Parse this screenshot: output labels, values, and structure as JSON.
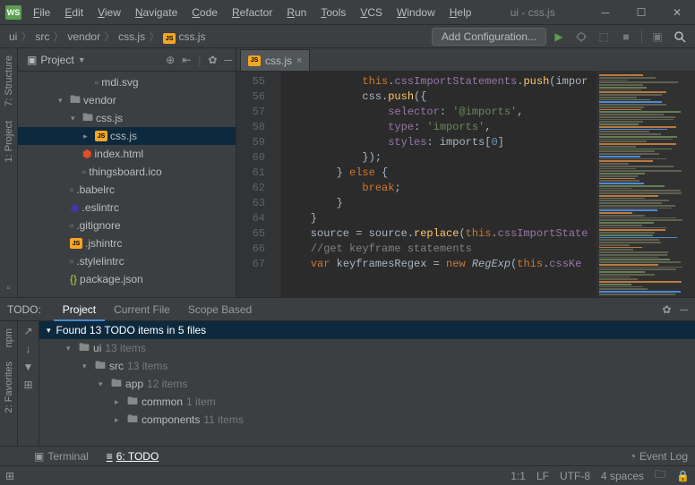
{
  "window": {
    "title": "ui - css.js"
  },
  "menu": [
    "File",
    "Edit",
    "View",
    "Navigate",
    "Code",
    "Refactor",
    "Run",
    "Tools",
    "VCS",
    "Window",
    "Help"
  ],
  "breadcrumbs": [
    "ui",
    "src",
    "vendor",
    "css.js",
    "css.js"
  ],
  "nav": {
    "add_config": "Add Configuration..."
  },
  "project_pane": {
    "title": "Project"
  },
  "tree": [
    {
      "indent": 66,
      "icon": "file",
      "label": "mdi.svg",
      "caret": ""
    },
    {
      "indent": 38,
      "icon": "folder",
      "label": "vendor",
      "caret": "▾"
    },
    {
      "indent": 52,
      "icon": "folder",
      "label": "css.js",
      "caret": "▾"
    },
    {
      "indent": 66,
      "icon": "js",
      "label": "css.js",
      "caret": "▸",
      "sel": true
    },
    {
      "indent": 52,
      "icon": "html",
      "label": "index.html",
      "caret": ""
    },
    {
      "indent": 52,
      "icon": "img",
      "label": "thingsboard.ico",
      "caret": ""
    },
    {
      "indent": 38,
      "icon": "file",
      "label": ".babelrc",
      "caret": ""
    },
    {
      "indent": 38,
      "icon": "eslint",
      "label": ".eslintrc",
      "caret": ""
    },
    {
      "indent": 38,
      "icon": "file",
      "label": ".gitignore",
      "caret": ""
    },
    {
      "indent": 38,
      "icon": "js",
      "label": ".jshintrc",
      "caret": ""
    },
    {
      "indent": 38,
      "icon": "file",
      "label": ".stylelintrc",
      "caret": ""
    },
    {
      "indent": 38,
      "icon": "json",
      "label": "package.json",
      "caret": ""
    }
  ],
  "editor": {
    "tab": "css.js",
    "first_line": 55,
    "lines": [
      {
        "n": 55,
        "html": "            <span class='this'>this</span>.<span class='prop'>cssImportStatements</span>.<span class='fn'>push</span>(impor"
      },
      {
        "n": 56,
        "html": "            css.<span class='fn'>push</span>({"
      },
      {
        "n": 57,
        "html": "                <span class='prop'>selector</span>: <span class='str'>'@imports'</span>,"
      },
      {
        "n": 58,
        "html": "                <span class='prop'>type</span>: <span class='str'>'imports'</span>,"
      },
      {
        "n": 59,
        "html": "                <span class='prop'>styles</span>: imports[<span class='num'>0</span>]"
      },
      {
        "n": 60,
        "html": "            });"
      },
      {
        "n": 61,
        "html": "        } <span class='kw'>else</span> {"
      },
      {
        "n": 62,
        "html": "            <span class='kw'>break</span>;"
      },
      {
        "n": 63,
        "html": "        }"
      },
      {
        "n": 64,
        "html": "    }"
      },
      {
        "n": 65,
        "html": "    source = source.<span class='fn'>replace</span>(<span class='this'>this</span>.<span class='prop'>cssImportState</span>"
      },
      {
        "n": 66,
        "html": "    <span class='cm'>//get keyframe statements</span>"
      },
      {
        "n": 67,
        "html": "    <span class='kw'>var</span> keyframesRegex = <span class='new'>new</span> <span class='type'>RegExp</span>(<span class='this'>this</span>.<span class='prop'>cssKe</span>"
      }
    ]
  },
  "todo": {
    "title": "TODO:",
    "tabs": [
      "Project",
      "Current File",
      "Scope Based"
    ],
    "header": "Found 13 TODO items in 5 files",
    "rows": [
      {
        "indent": 26,
        "caret": "▾",
        "icon": "folder",
        "label": "ui",
        "count": "13 items"
      },
      {
        "indent": 44,
        "caret": "▾",
        "icon": "folder",
        "label": "src",
        "count": "13 items"
      },
      {
        "indent": 62,
        "caret": "▾",
        "icon": "folder",
        "label": "app",
        "count": "12 items"
      },
      {
        "indent": 80,
        "caret": "▸",
        "icon": "folder",
        "label": "common",
        "count": "1 item"
      },
      {
        "indent": 80,
        "caret": "▸",
        "icon": "folder",
        "label": "components",
        "count": "11 items"
      }
    ]
  },
  "bottombar": {
    "terminal": "Terminal",
    "todo": "6: TODO",
    "eventlog": "Event Log"
  },
  "status": {
    "pos": "1:1",
    "le": "LF",
    "enc": "UTF-8",
    "indent": "4 spaces"
  },
  "left_tabs": [
    "7: Structure",
    "1: Project"
  ],
  "left_tabs2": [
    "npm",
    "2: Favorites"
  ]
}
